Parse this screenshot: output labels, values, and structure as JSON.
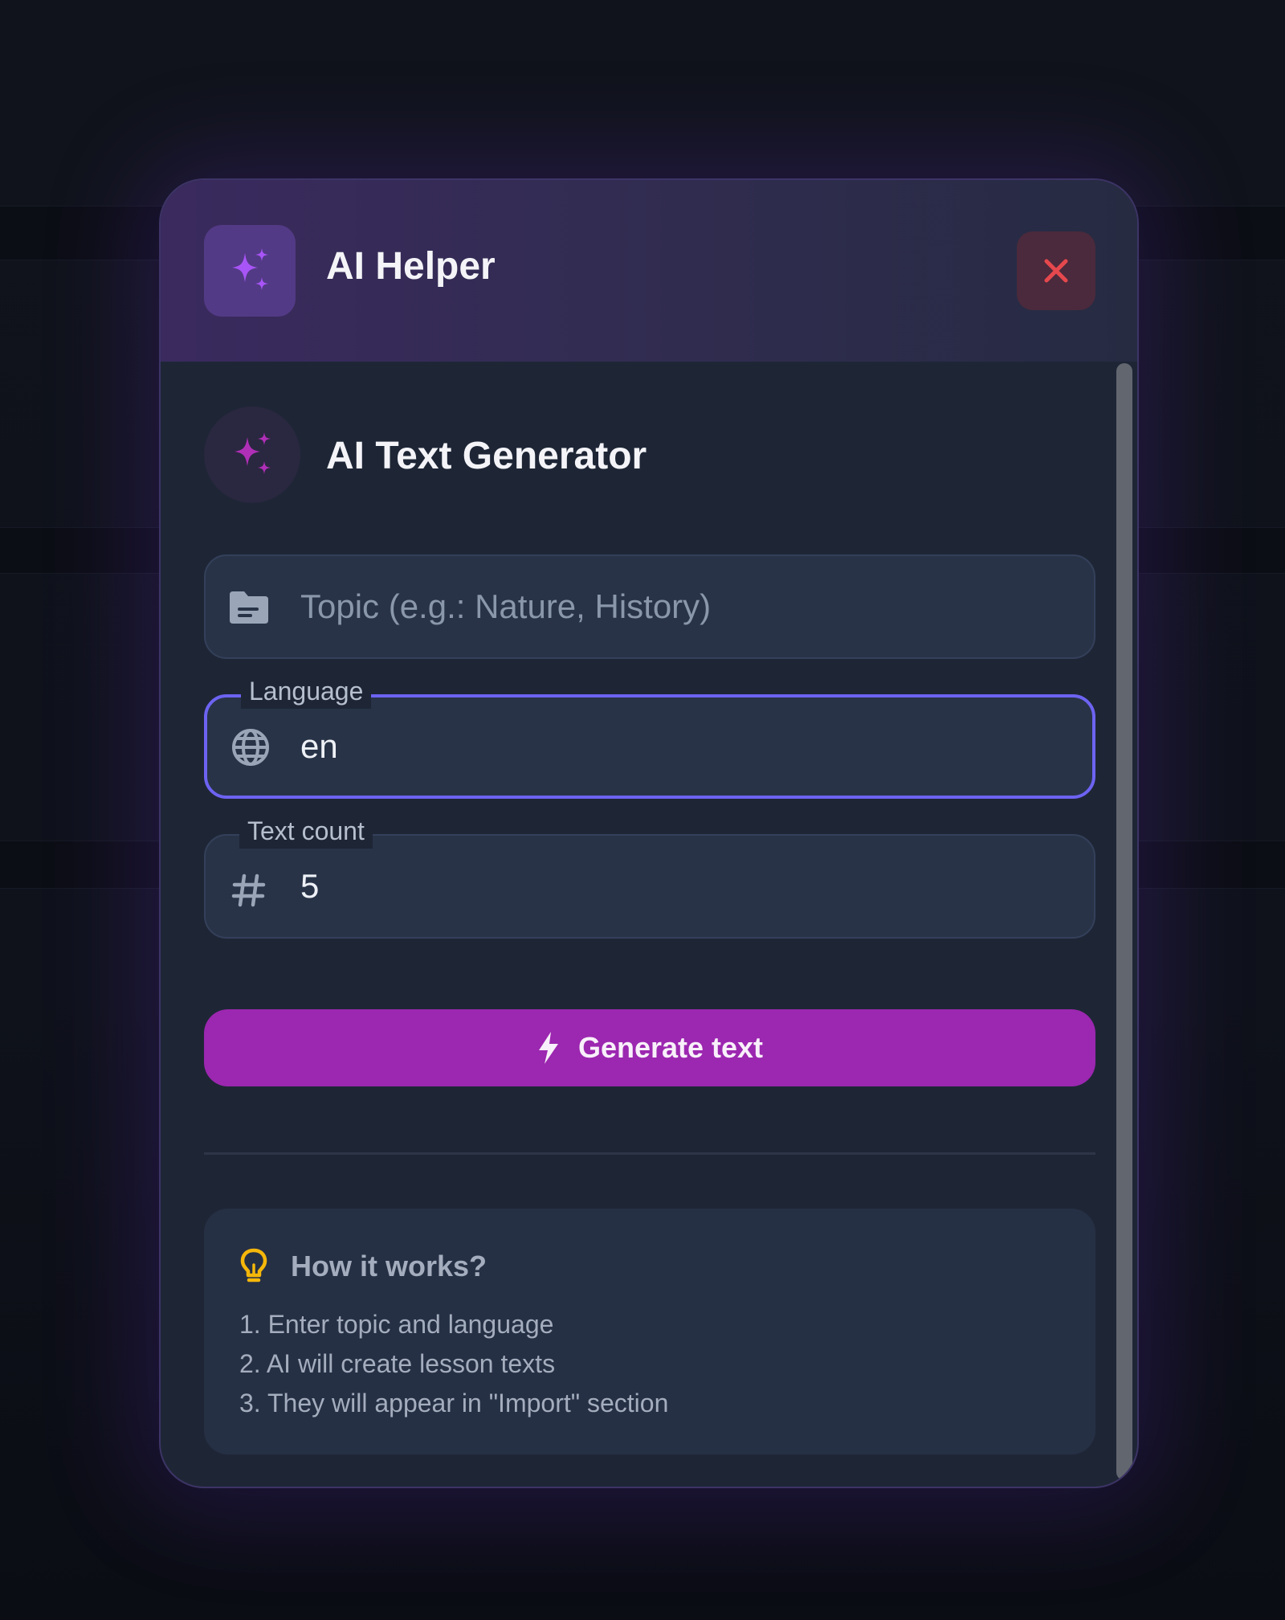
{
  "dialog": {
    "title": "AI Helper",
    "header_icon": "sparkles-icon",
    "close_icon": "close-icon",
    "colors": {
      "accent": "#9c27b0",
      "focus_ring": "#6d63f2",
      "close": "#e5484d",
      "sparkle": "#a855f7",
      "bulb": "#f5b70a"
    }
  },
  "generator": {
    "title": "AI Text Generator",
    "icon": "sparkles-icon",
    "topic": {
      "placeholder": "Topic (e.g.: Nature, History)",
      "value": "",
      "icon": "folder-icon"
    },
    "language": {
      "label": "Language",
      "value": "en",
      "icon": "globe-icon"
    },
    "text_count": {
      "label": "Text count",
      "value": "5",
      "icon": "hash-icon"
    },
    "generate_button": {
      "label": "Generate text",
      "icon": "lightning-icon"
    }
  },
  "how_it_works": {
    "icon": "lightbulb-icon",
    "title": "How it works?",
    "steps": [
      "1. Enter topic and language",
      "2. AI will create lesson texts",
      "3. They will appear in \"Import\" section"
    ]
  }
}
